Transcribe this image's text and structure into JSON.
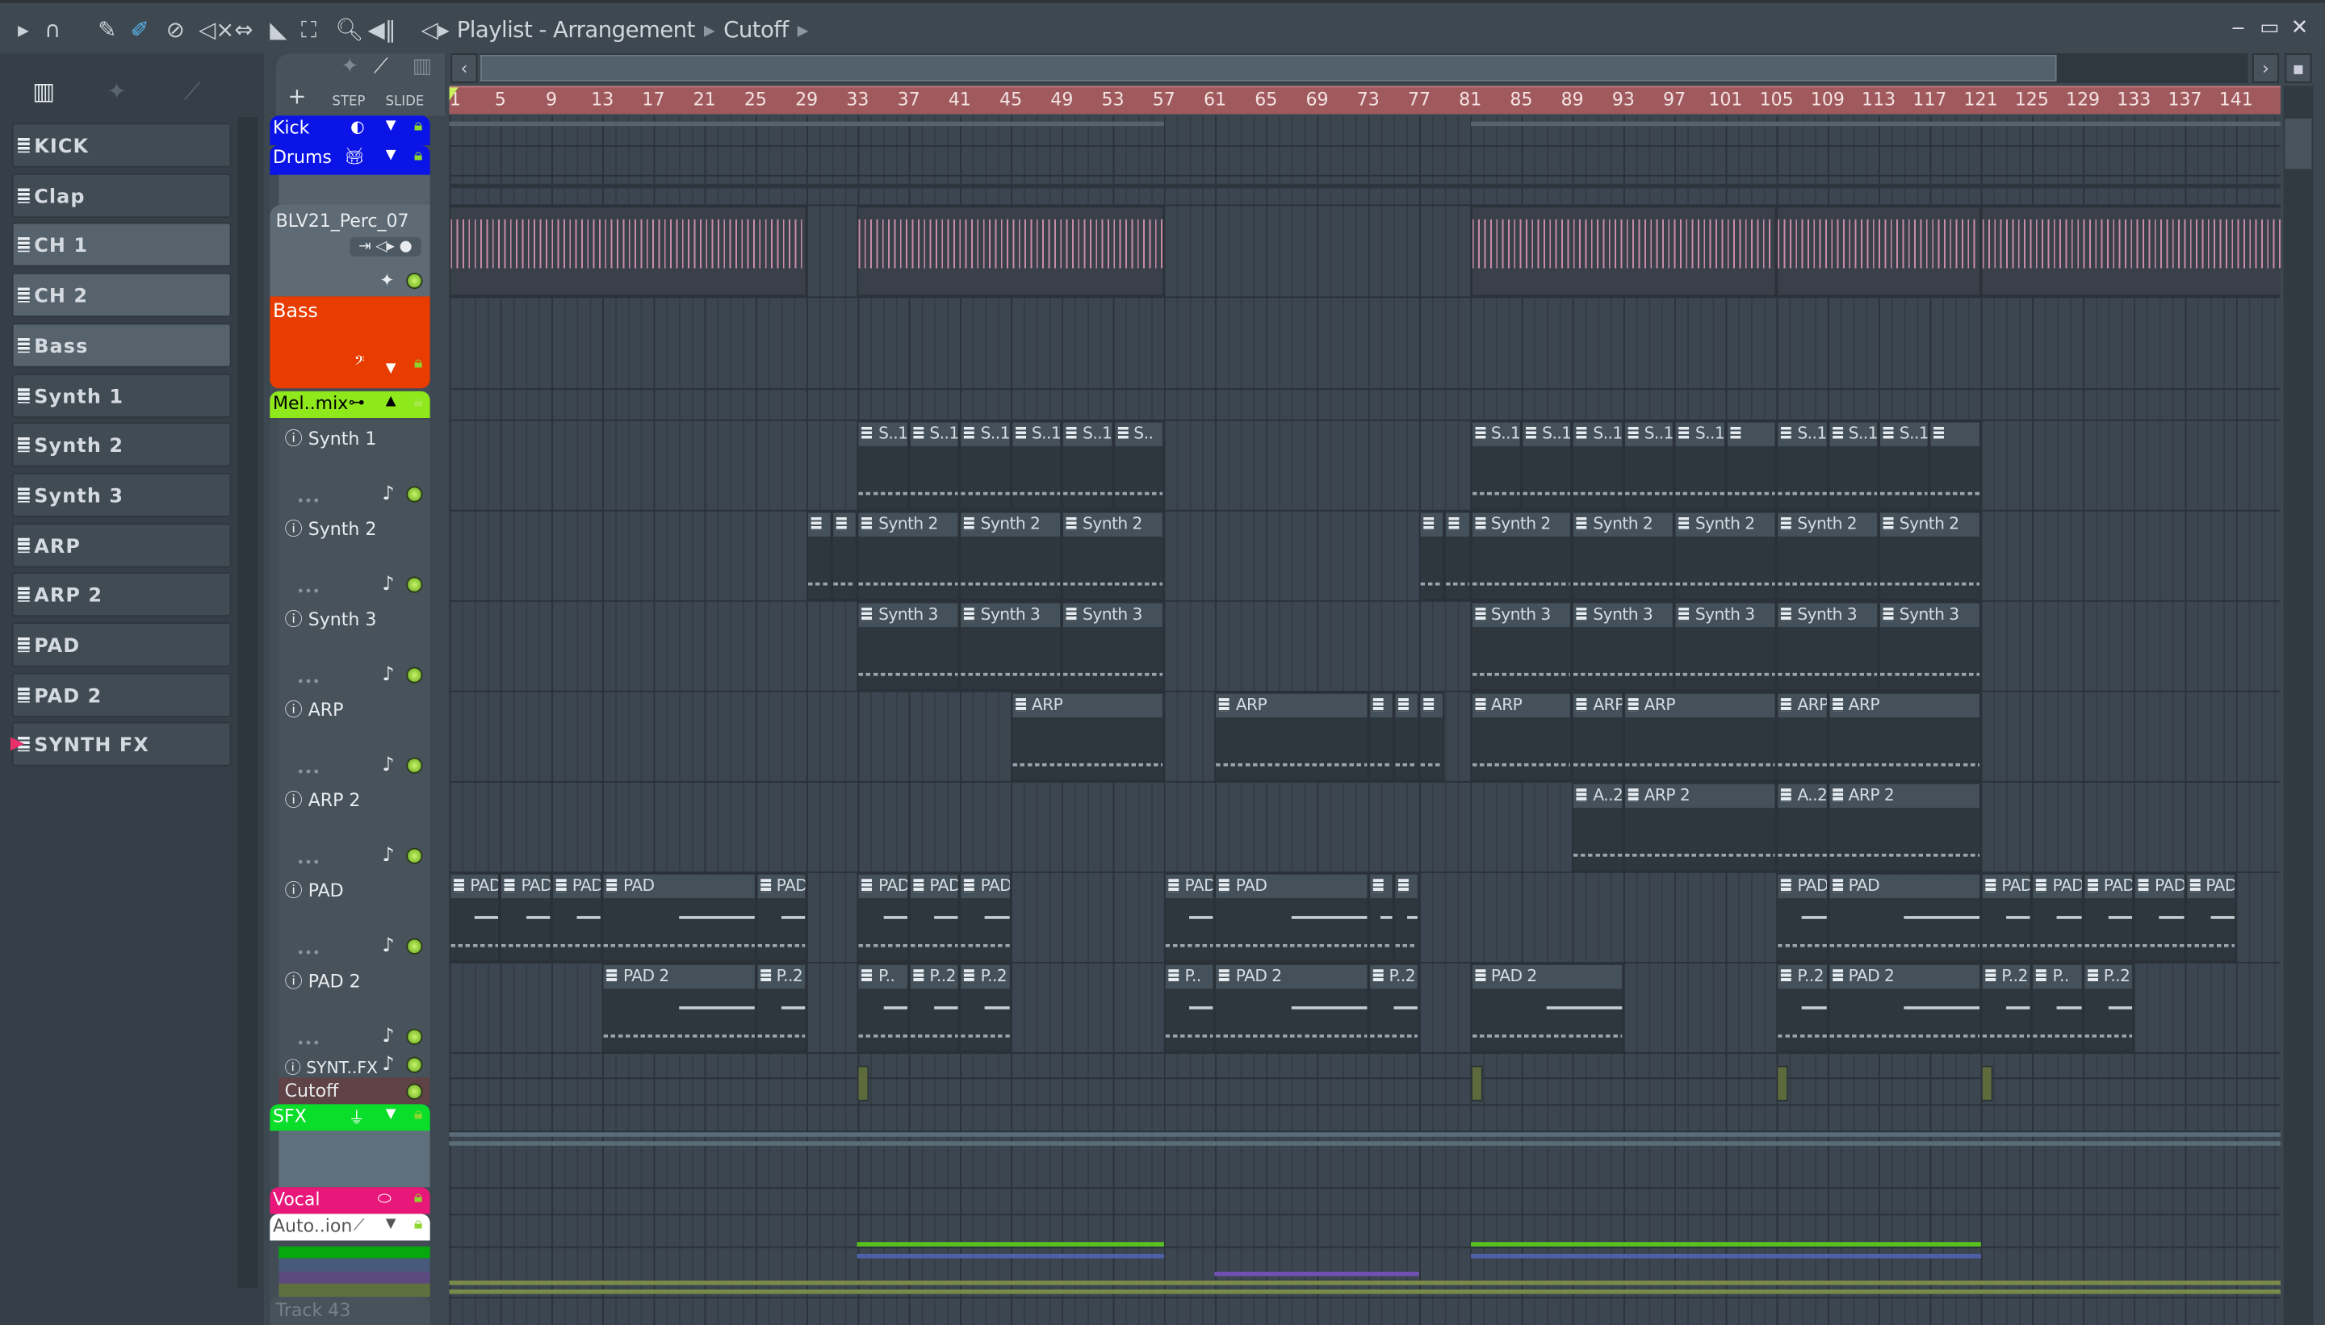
{
  "window": {
    "title": "Playlist - Arrangement",
    "breadcrumb": "Cutoff",
    "minimize": "‒",
    "maximize": "▭",
    "close": "✕"
  },
  "toolbar": {
    "icons": [
      "play-arrow-icon",
      "magnet-snap-icon",
      "pencil-icon",
      "paint-brush-icon",
      "delete-icon",
      "mute-icon",
      "slip-icon",
      "slice-icon",
      "select-icon",
      "zoom-icon",
      "playback-icon",
      "speaker-icon"
    ]
  },
  "pattern_selector": {
    "step_label": "STEP",
    "slide_label": "SLIDE",
    "add_label": "+"
  },
  "channels": [
    {
      "name": "KICK"
    },
    {
      "name": "Clap"
    },
    {
      "name": "CH 1",
      "selected": true
    },
    {
      "name": "CH 2",
      "selected": true
    },
    {
      "name": "Bass",
      "selected": true
    },
    {
      "name": "Synth 1"
    },
    {
      "name": "Synth 2"
    },
    {
      "name": "Synth 3"
    },
    {
      "name": "ARP"
    },
    {
      "name": "ARP 2"
    },
    {
      "name": "PAD"
    },
    {
      "name": "PAD 2"
    },
    {
      "name": "SYNTH FX"
    }
  ],
  "left_add": "+",
  "track_headers": {
    "kick": {
      "name": "Kick",
      "color": "#0a14e6"
    },
    "drums": {
      "name": "Drums",
      "color": "#0a14e6"
    },
    "perc": {
      "name": "BLV21_Perc_07"
    },
    "bass": {
      "name": "Bass",
      "color": "#e83c00"
    },
    "melmix": {
      "name": "Mel..mix",
      "color": "#8ee81c"
    },
    "synth1": {
      "name": "Synth 1"
    },
    "synth2": {
      "name": "Synth 2"
    },
    "synth3": {
      "name": "Synth 3"
    },
    "arp": {
      "name": "ARP"
    },
    "arp2": {
      "name": "ARP 2"
    },
    "pad": {
      "name": "PAD"
    },
    "pad2": {
      "name": "PAD 2"
    },
    "syntfx": {
      "name": "SYNT..FX"
    },
    "cutoff": {
      "name": "Cutoff",
      "color": "#5e4245"
    },
    "sfx": {
      "name": "SFX",
      "color": "#0add2a"
    },
    "vocal": {
      "name": "Vocal",
      "color": "#e8187a"
    },
    "auto": {
      "name": "Auto..ion",
      "color": "#ffffff"
    },
    "track43": {
      "name": "Track 43"
    }
  },
  "ruler": {
    "bars": [
      1,
      5,
      9,
      13,
      17,
      21,
      25,
      29,
      33,
      37,
      41,
      45,
      49,
      53,
      57,
      61,
      65,
      69,
      73,
      77,
      81,
      85,
      89,
      93,
      97,
      101,
      105,
      109,
      113,
      117,
      121,
      125,
      129,
      133,
      137,
      141
    ]
  },
  "clips": {
    "synth1": [
      [
        33,
        4,
        "S..1"
      ],
      [
        37,
        4,
        "S..1"
      ],
      [
        41,
        4,
        "S..1"
      ],
      [
        45,
        4,
        "S..1"
      ],
      [
        49,
        4,
        "S..1"
      ],
      [
        53,
        4,
        "S.."
      ],
      [
        81,
        4,
        "S..1"
      ],
      [
        85,
        4,
        "S..1"
      ],
      [
        89,
        4,
        "S..1"
      ],
      [
        93,
        4,
        "S..1"
      ],
      [
        97,
        4,
        "S..1"
      ],
      [
        101,
        4,
        ""
      ],
      [
        105,
        4,
        "S..1"
      ],
      [
        109,
        4,
        "S..1"
      ],
      [
        113,
        4,
        "S..1"
      ],
      [
        117,
        4,
        ""
      ]
    ],
    "synth2": [
      [
        29,
        2,
        ""
      ],
      [
        31,
        2,
        ""
      ],
      [
        33,
        8,
        "Synth 2"
      ],
      [
        41,
        8,
        "Synth 2"
      ],
      [
        49,
        8,
        "Synth 2"
      ],
      [
        77,
        2,
        ""
      ],
      [
        79,
        2,
        ""
      ],
      [
        81,
        8,
        "Synth 2"
      ],
      [
        89,
        8,
        "Synth 2"
      ],
      [
        97,
        8,
        "Synth 2"
      ],
      [
        105,
        8,
        "Synth 2"
      ],
      [
        113,
        8,
        "Synth 2"
      ]
    ],
    "synth3": [
      [
        33,
        8,
        "Synth 3"
      ],
      [
        41,
        8,
        "Synth 3"
      ],
      [
        49,
        8,
        "Synth 3"
      ],
      [
        81,
        8,
        "Synth 3"
      ],
      [
        89,
        8,
        "Synth 3"
      ],
      [
        97,
        8,
        "Synth 3"
      ],
      [
        105,
        8,
        "Synth 3"
      ],
      [
        113,
        8,
        "Synth 3"
      ]
    ],
    "arp": [
      [
        45,
        12,
        "ARP"
      ],
      [
        61,
        12,
        "ARP"
      ],
      [
        73,
        2,
        ""
      ],
      [
        75,
        2,
        ""
      ],
      [
        77,
        2,
        ""
      ],
      [
        81,
        8,
        "ARP"
      ],
      [
        89,
        4,
        "ARP"
      ],
      [
        93,
        12,
        "ARP"
      ],
      [
        105,
        4,
        "ARP"
      ],
      [
        109,
        12,
        "ARP"
      ]
    ],
    "arp2": [
      [
        89,
        4,
        "A..2"
      ],
      [
        93,
        12,
        "ARP 2"
      ],
      [
        105,
        4,
        "A..2"
      ],
      [
        109,
        12,
        "ARP 2"
      ]
    ],
    "pad": [
      [
        1,
        4,
        "PAD"
      ],
      [
        5,
        4,
        "PAD"
      ],
      [
        9,
        4,
        "PAD"
      ],
      [
        13,
        12,
        "PAD"
      ],
      [
        25,
        4,
        "PAD"
      ],
      [
        33,
        4,
        "PAD"
      ],
      [
        37,
        4,
        "PAD"
      ],
      [
        41,
        4,
        "PAD"
      ],
      [
        57,
        4,
        "PAD"
      ],
      [
        61,
        12,
        "PAD"
      ],
      [
        73,
        2,
        ""
      ],
      [
        75,
        2,
        ""
      ],
      [
        105,
        4,
        "PAD"
      ],
      [
        109,
        12,
        "PAD"
      ],
      [
        121,
        4,
        "PAD"
      ],
      [
        125,
        4,
        "PAD"
      ],
      [
        129,
        4,
        "PAD"
      ],
      [
        133,
        4,
        "PAD"
      ],
      [
        137,
        4,
        "PAD"
      ]
    ],
    "pad2": [
      [
        13,
        12,
        "PAD 2"
      ],
      [
        25,
        4,
        "P..2"
      ],
      [
        33,
        4,
        "P.."
      ],
      [
        37,
        4,
        "P..2"
      ],
      [
        41,
        4,
        "P..2"
      ],
      [
        57,
        4,
        "P.."
      ],
      [
        61,
        12,
        "PAD 2"
      ],
      [
        73,
        4,
        "P..2"
      ],
      [
        81,
        12,
        "PAD 2"
      ],
      [
        105,
        4,
        "P..2"
      ],
      [
        109,
        12,
        "PAD 2"
      ],
      [
        121,
        4,
        "P..2"
      ],
      [
        125,
        4,
        "P.."
      ],
      [
        129,
        4,
        "P..2"
      ]
    ],
    "perc": [
      [
        1,
        28,
        ""
      ],
      [
        33,
        24,
        ""
      ],
      [
        81,
        24,
        ""
      ],
      [
        105,
        16,
        ""
      ],
      [
        121,
        24,
        ""
      ]
    ],
    "cutoff": [
      [
        33,
        1,
        ""
      ],
      [
        81,
        1,
        ""
      ],
      [
        105,
        1,
        ""
      ],
      [
        121,
        1,
        ""
      ]
    ]
  },
  "colors": {
    "ruler": "#a05a5e",
    "background": "#3d4750",
    "accent_green": "#8ee81c"
  }
}
